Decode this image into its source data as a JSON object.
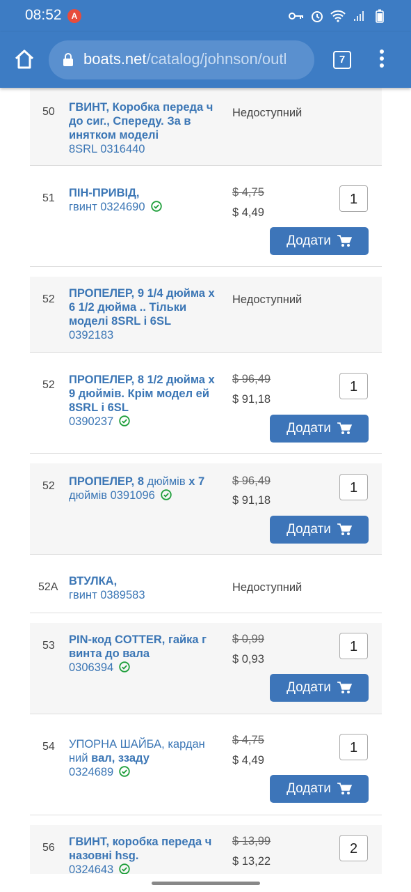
{
  "status": {
    "time": "08:52",
    "alert": "A"
  },
  "browser": {
    "url_domain": "boats.net",
    "url_path": "/catalog/johnson/outl",
    "tab_count": "7"
  },
  "items": [
    {
      "num": "50",
      "title": "ГВИНТ, Коробка переда ч до сиг., Спереду. За в инятком моделі",
      "pn": "8SRL 0316440",
      "status": "Недоступний"
    },
    {
      "num": "51",
      "title": "ПІН-ПРИВІД,",
      "title2": "гвинт 0324690",
      "old": "$ 4,75",
      "new": "$ 4,49",
      "qty": "1",
      "add": "Додати"
    },
    {
      "num": "52",
      "title": "ПРОПЕЛЕР, 9 1/4 дюйма х 6 1/2 дюйма .. Тільки моделі 8SRL і 6SL",
      "pn": "0392183",
      "status": "Недоступний"
    },
    {
      "num": "52",
      "title": "ПРОПЕЛЕР, 8 1/2 дюйма х 9 дюймів. Крім модел ей 8SRL і 6SL",
      "pn": "0390237",
      "old": "$ 96,49",
      "new": "$ 91,18",
      "qty": "1",
      "add": "Додати"
    },
    {
      "num": "52",
      "title_a": "ПРОПЕЛЕР, 8",
      "title_b": "дюймів",
      "title_c": "х 7",
      "title2": "дюймів 0391096",
      "old": "$ 96,49",
      "new": "$ 91,18",
      "qty": "1",
      "add": "Додати"
    },
    {
      "num": "52A",
      "title": "ВТУЛКА,",
      "title2": "гвинт 0389583",
      "status": "Недоступний"
    },
    {
      "num": "53",
      "title": "PIN-код COTTER, гайка г винта до вала",
      "pn": "0306394",
      "old": "$ 0,99",
      "new": "$ 0,93",
      "qty": "1",
      "add": "Додати"
    },
    {
      "num": "54",
      "title_a": "УПОРНА ШАЙБА, кардан ний",
      "title_b": "вал, ззаду",
      "pn": "0324689",
      "old": "$ 4,75",
      "new": "$ 4,49",
      "qty": "1",
      "add": "Додати"
    },
    {
      "num": "56",
      "title": "ГВИНТ, коробка переда ч назовні hsg.",
      "pn": "0324643",
      "old": "$ 13,99",
      "new": "$ 13,22",
      "qty": "2"
    }
  ]
}
